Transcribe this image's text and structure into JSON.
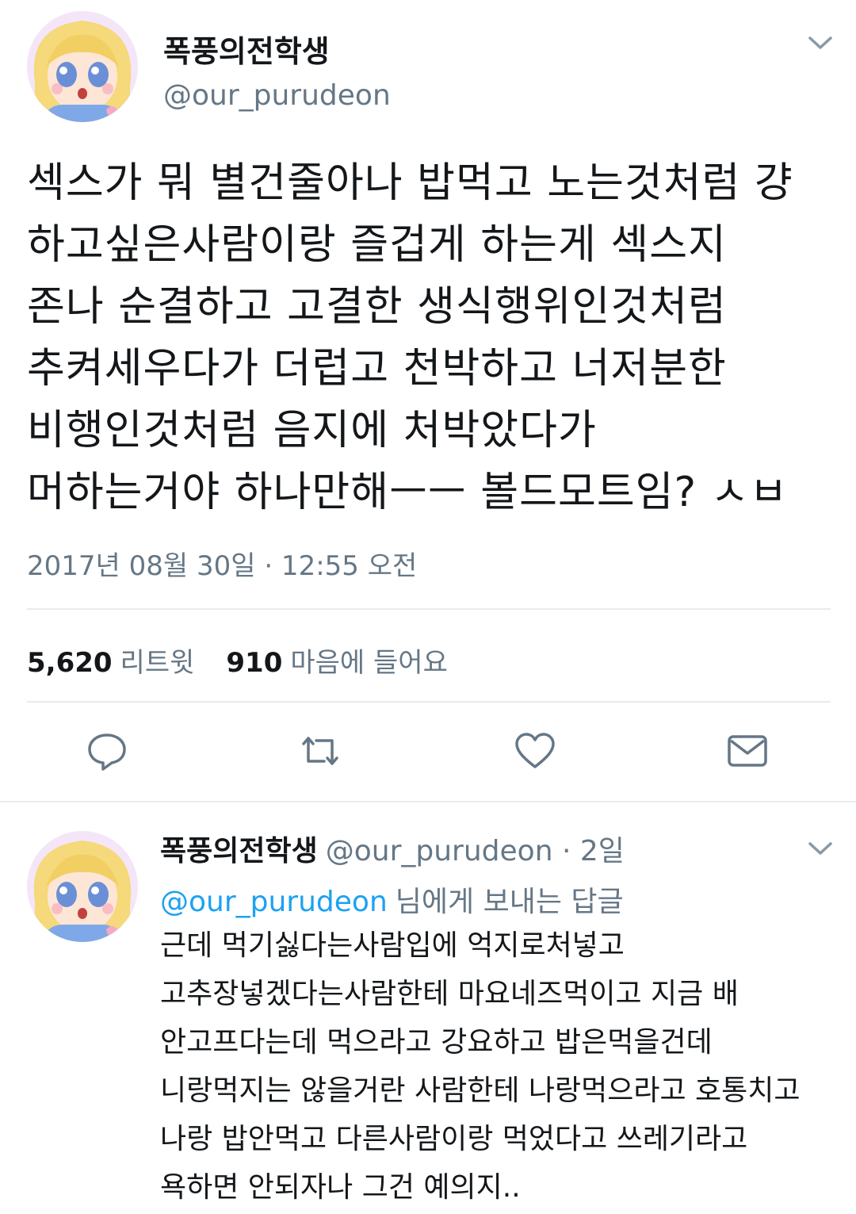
{
  "tweet": {
    "author_name": "폭풍의전학생",
    "author_handle": "@our_purudeon",
    "text_lines": [
      "섹스가 뭐 별건줄아나 밥먹고 노는것처럼 걍",
      "하고싶은사람이랑 즐겁게 하는게 섹스지",
      "존나 순결하고 고결한 생식행위인것처럼",
      "추켜세우다가 더럽고 천박하고 너저분한",
      "비행인것처럼 음지에 처박았다가",
      "머하는거야 하나만해ㅡㅡ 볼드모트임? ㅅㅂ"
    ],
    "timestamp": "2017년 08월 30일 · 12:55 오전",
    "retweet_count": "5,620",
    "retweet_label": "리트윗",
    "like_count": "910",
    "like_label": "마음에 들어요"
  },
  "icons": {
    "menu": "chevron-down-icon",
    "reply": "speech-bubble-icon",
    "retweet": "retweet-arrows-icon",
    "like": "heart-icon",
    "dm": "envelope-icon"
  },
  "reply": {
    "author_name": "폭풍의전학생",
    "author_handle_time": "@our_purudeon · 2일",
    "mention": "@our_purudeon",
    "reply_to_suffix": "님에게 보내는 답글",
    "text_lines": [
      "근데 먹기싫다는사람입에 억지로처넣고",
      "고추장넣겠다는사람한테 마요네즈먹이고 지금 배",
      "안고프다는데 먹으라고 강요하고 밥은먹을건데",
      "니랑먹지는 않을거란 사람한테 나랑먹으라고 호통치고",
      "나랑 밥안먹고 다른사람이랑 먹었다고 쓰레기라고",
      "욕하면 안되자나 그건 예의지.."
    ]
  },
  "colors": {
    "text": "#14171a",
    "secondary": "#657786",
    "link": "#1da1f2",
    "divider": "#e6ecf0"
  }
}
